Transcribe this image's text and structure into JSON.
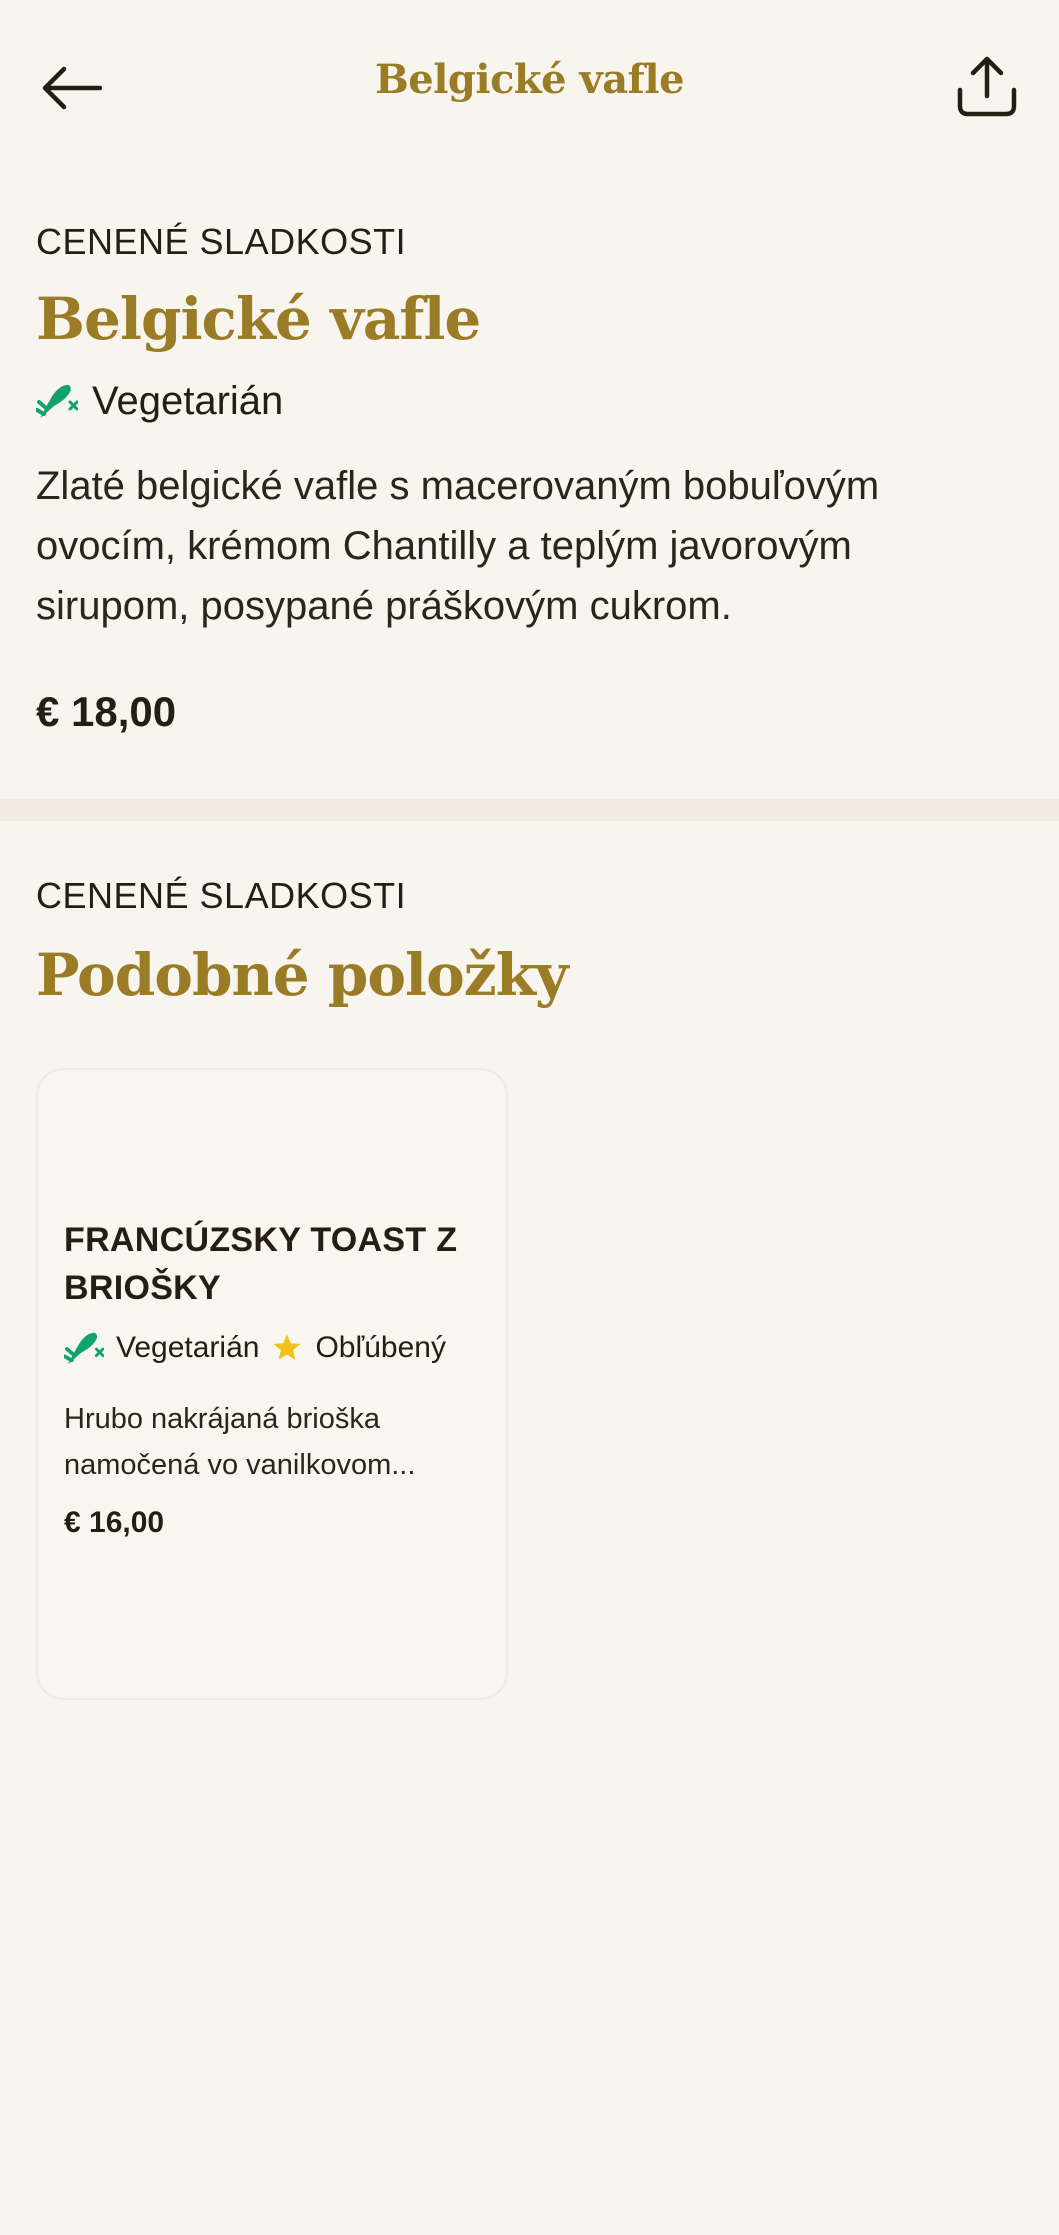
{
  "header": {
    "title": "Belgické vafle",
    "back_icon": "arrow-left-icon",
    "share_icon": "share-icon"
  },
  "item": {
    "category": "CENENÉ SLADKOSTI",
    "title": "Belgické vafle",
    "diet_label": "Vegetarián",
    "description": "Zlaté belgické vafle s macerovaným bobuľovým ovocím, krémom Chantilly a teplým javorovým sirupom, posypané práškovým cukrom.",
    "price": "€ 18,00"
  },
  "similar": {
    "category": "CENENÉ SLADKOSTI",
    "title": "Podobné položky",
    "items": [
      {
        "title": "FRANCÚZSKY TOAST Z BRIOŠKY",
        "diet_label": "Vegetarián",
        "favorite_label": "Obľúbený",
        "description": "Hrubo nakrájaná brioška namočená vo vanilkovom...",
        "price": "€ 16,00"
      }
    ]
  },
  "colors": {
    "background": "#f8f5ef",
    "accent": "#9a7b26",
    "veg_green": "#10a36b",
    "star": "#f2c21b",
    "text": "#231f14"
  }
}
